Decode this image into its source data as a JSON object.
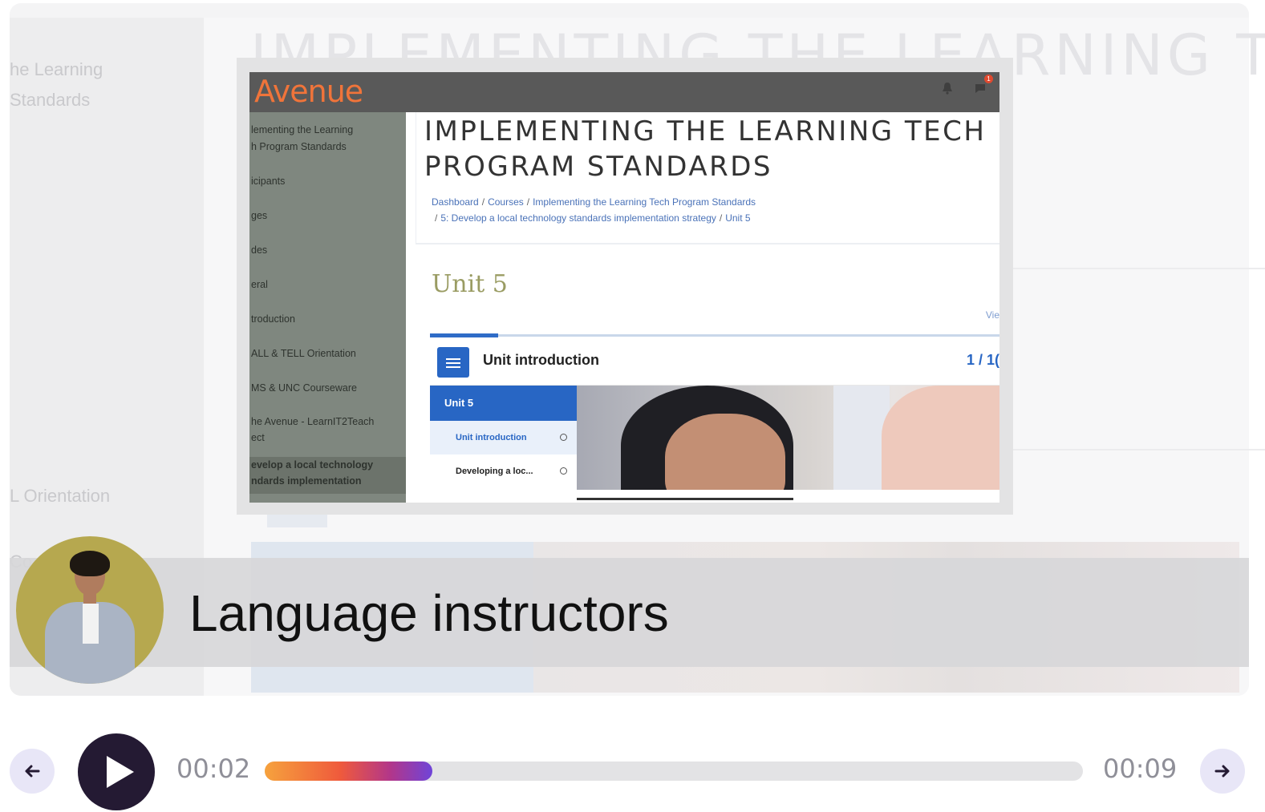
{
  "background_slide": {
    "title": "IMPLEMENTING THE LEARNING TE",
    "sidebar_lines": [
      "he Learning",
      "Standards",
      "L Orientation",
      "Co"
    ]
  },
  "embedded_screenshot": {
    "brand": "Avenue",
    "notification_badge": "1",
    "sidebar": [
      "lementing the Learning",
      "h Program Standards",
      "icipants",
      "ges",
      "des",
      "eral",
      "troduction",
      "ALL & TELL Orientation",
      "MS & UNC Courseware",
      "he Avenue - LearnIT2Teach",
      "ect",
      "evelop a local technology",
      "ndards implementation"
    ],
    "course_title_line1": "IMPLEMENTING THE LEARNING TECH",
    "course_title_line2": "PROGRAM STANDARDS",
    "breadcrumbs": [
      "Dashboard",
      "Courses",
      "Implementing the Learning Tech Program Standards",
      "5: Develop a local technology standards implementation strategy",
      "Unit 5"
    ],
    "unit_heading": "Unit 5",
    "view_link": "Vie",
    "progress_fraction": 0.12,
    "unit_intro_label": "Unit introduction",
    "unit_count": "1 / 1(",
    "toc_header": "Unit 5",
    "toc_items": [
      "Unit introduction",
      "Developing a loc..."
    ]
  },
  "caption": {
    "text": "Language instructors"
  },
  "player": {
    "current_time": "00:02",
    "total_time": "00:09",
    "progress": 0.205,
    "accent_start": "#f6a23d",
    "accent_end": "#6f44d8",
    "prev_icon": "arrow-left-icon",
    "play_icon": "play-icon",
    "next_icon": "arrow-right-icon"
  }
}
